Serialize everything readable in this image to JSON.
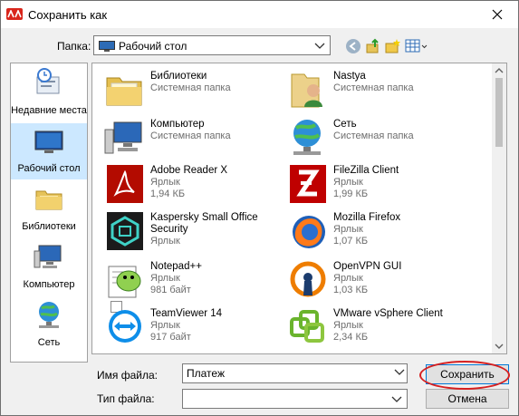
{
  "window": {
    "title": "Сохранить как"
  },
  "toolbar": {
    "folder_label": "Папка:",
    "folder_value": "Рабочий стол"
  },
  "places": [
    {
      "label": "Недавние места",
      "icon": "recent-places-icon"
    },
    {
      "label": "Рабочий стол",
      "icon": "desktop-icon",
      "active": true
    },
    {
      "label": "Библиотеки",
      "icon": "libraries-icon"
    },
    {
      "label": "Компьютер",
      "icon": "computer-icon"
    },
    {
      "label": "Сеть",
      "icon": "network-icon"
    }
  ],
  "files": [
    {
      "name": "Библиотеки",
      "line1": "Системная папка",
      "line2": "",
      "icon": "libraries-folder-icon"
    },
    {
      "name": "Nastya",
      "line1": "Системная папка",
      "line2": "",
      "icon": "user-folder-icon"
    },
    {
      "name": "Компьютер",
      "line1": "Системная папка",
      "line2": "",
      "icon": "computer-icon"
    },
    {
      "name": "Сеть",
      "line1": "Системная папка",
      "line2": "",
      "icon": "network-icon"
    },
    {
      "name": "Adobe Reader X",
      "line1": "Ярлык",
      "line2": "1,94 КБ",
      "icon": "adobe-reader-icon"
    },
    {
      "name": "FileZilla Client",
      "line1": "Ярлык",
      "line2": "1,99 КБ",
      "icon": "filezilla-icon"
    },
    {
      "name": "Kaspersky Small Office Security",
      "line1": "Ярлык",
      "line2": "",
      "icon": "kaspersky-icon"
    },
    {
      "name": "Mozilla Firefox",
      "line1": "Ярлык",
      "line2": "1,07 КБ",
      "icon": "firefox-icon"
    },
    {
      "name": "Notepad++",
      "line1": "Ярлык",
      "line2": "981 байт",
      "icon": "notepadpp-icon"
    },
    {
      "name": "OpenVPN GUI",
      "line1": "Ярлык",
      "line2": "1,03 КБ",
      "icon": "openvpn-icon"
    },
    {
      "name": "TeamViewer 14",
      "line1": "Ярлык",
      "line2": "917 байт",
      "icon": "teamviewer-icon"
    },
    {
      "name": "VMware vSphere Client",
      "line1": "Ярлык",
      "line2": "2,34 КБ",
      "icon": "vmware-icon"
    }
  ],
  "form": {
    "filename_label": "Имя файла:",
    "filename_value": "Платеж",
    "filetype_label": "Тип файла:",
    "filetype_value": ""
  },
  "buttons": {
    "save": "Сохранить",
    "cancel": "Отмена"
  },
  "colors": {
    "selection": "#cce8ff",
    "highlight_ring": "#d62020",
    "primary_border": "#0078d7"
  }
}
